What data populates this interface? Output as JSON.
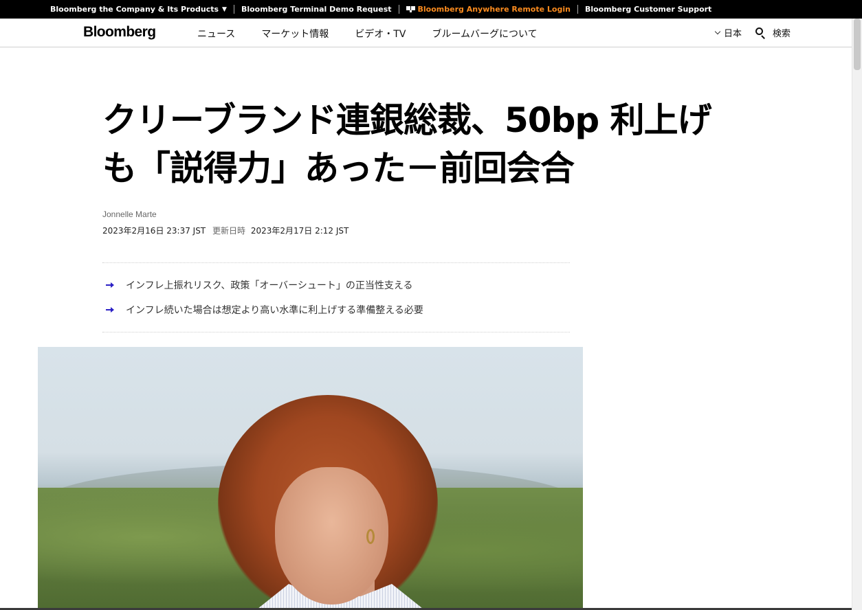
{
  "topbar": {
    "company": "Bloomberg the Company & Its Products",
    "caret": "▼",
    "terminal_demo": "Bloomberg Terminal Demo Request",
    "anywhere_login": "Bloomberg Anywhere Remote Login",
    "customer_support": "Bloomberg Customer Support",
    "accent_color": "#fb8b1e"
  },
  "nav": {
    "logo": "Bloomberg",
    "links": [
      "ニュース",
      "マーケット情報",
      "ビデオ・TV",
      "ブルームバーグについて"
    ],
    "region": "日本",
    "search_label": "検索"
  },
  "article": {
    "headline": "クリーブランド連銀総裁、50bp 利上げも「説得力」あった－前回会合",
    "author": "Jonnelle Marte",
    "published": "2023年2月16日 23:37 JST",
    "updated_label": "更新日時",
    "updated": "2023年2月17日 2:12 JST",
    "summary": [
      "インフレ上振れリスク、政策「オーバーシュート」の正当性支える",
      "インフレ続いた場合は想定より高い水準に利上げする準備整える必要"
    ],
    "bullet_color": "#2b20c5"
  }
}
